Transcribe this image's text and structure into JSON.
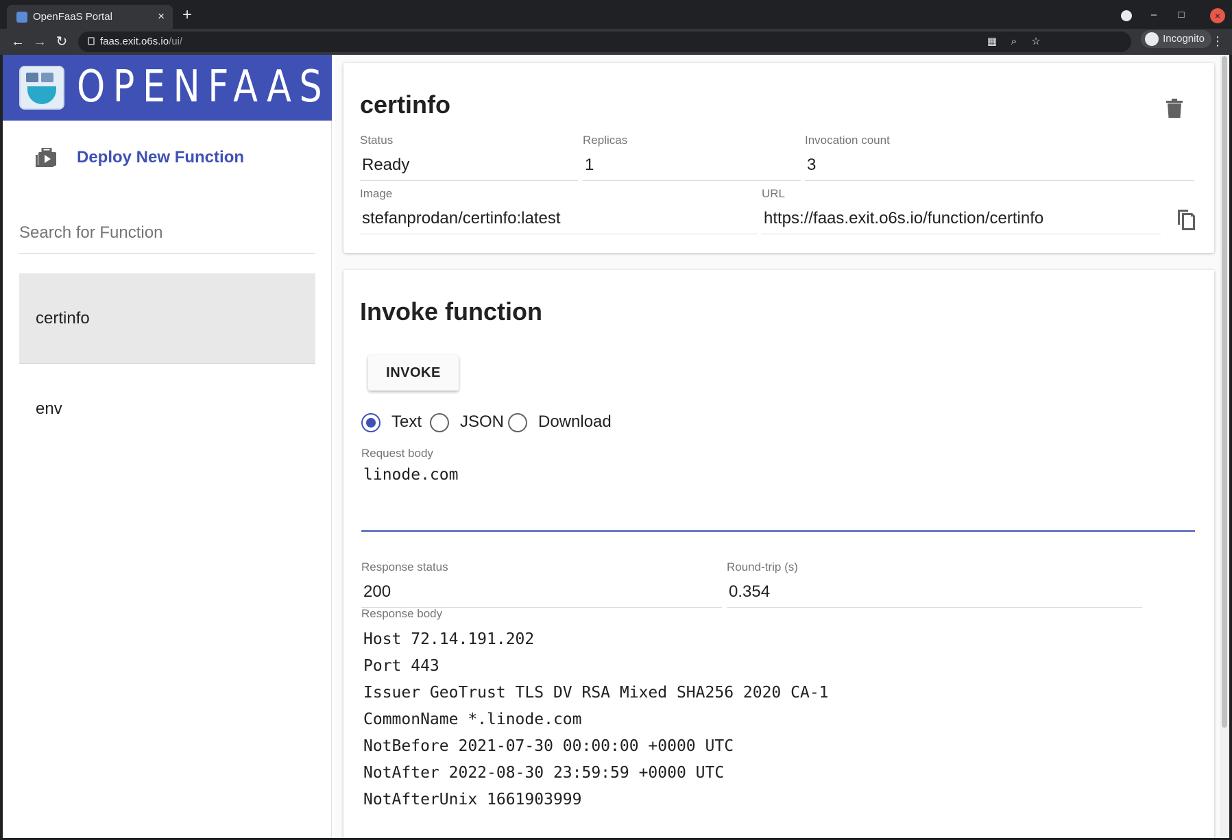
{
  "browser": {
    "tab_title": "OpenFaaS Portal",
    "tab_close": "×",
    "new_tab": "+",
    "url_host": "faas.exit.o6s.io",
    "url_path": "/ui/",
    "incognito_label": "Incognito",
    "window_controls": {
      "minimize": "–",
      "maximize": "□",
      "close": "×"
    }
  },
  "sidebar": {
    "brand_name": "OPENFAAS",
    "deploy_label": "Deploy New Function",
    "search_placeholder": "Search for Function",
    "functions": [
      {
        "name": "certinfo",
        "selected": true
      },
      {
        "name": "env",
        "selected": false
      }
    ]
  },
  "details": {
    "function_name": "certinfo",
    "status_label": "Status",
    "status_value": "Ready",
    "replicas_label": "Replicas",
    "replicas_value": "1",
    "invocation_label": "Invocation count",
    "invocation_value": "3",
    "image_label": "Image",
    "image_value": "stefanprodan/certinfo:latest",
    "url_label": "URL",
    "url_value": "https://faas.exit.o6s.io/function/certinfo"
  },
  "invoke": {
    "title": "Invoke function",
    "invoke_button": "INVOKE",
    "format_options": [
      "Text",
      "JSON",
      "Download"
    ],
    "selected_format": "Text",
    "request_body_label": "Request body",
    "request_body_value": "linode.com",
    "response_status_label": "Response status",
    "response_status_value": "200",
    "round_trip_label": "Round-trip (s)",
    "round_trip_value": "0.354",
    "response_body_label": "Response body",
    "response_body_lines": [
      "Host 72.14.191.202",
      "Port 443",
      "Issuer GeoTrust TLS DV RSA Mixed SHA256 2020 CA-1",
      "CommonName *.linode.com",
      "NotBefore 2021-07-30 00:00:00 +0000 UTC",
      "NotAfter 2022-08-30 23:59:59 +0000 UTC",
      "NotAfterUnix 1661903999"
    ]
  },
  "colors": {
    "primary": "#3f51b5",
    "selected_bg": "#e8e8e8"
  },
  "icons": {
    "deploy": "deploy-function-icon",
    "delete": "trash-icon",
    "copy": "copy-icon"
  }
}
